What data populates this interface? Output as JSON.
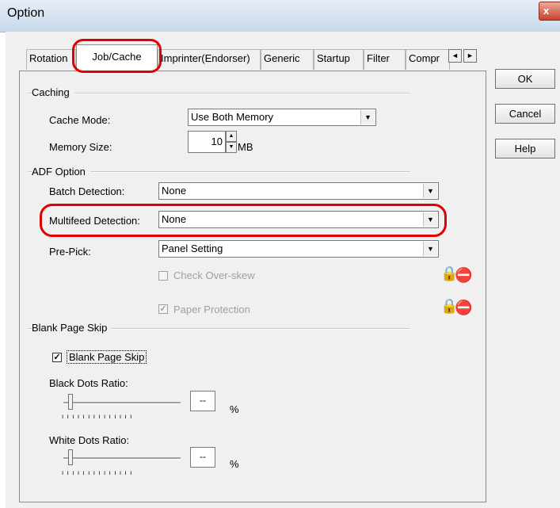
{
  "window": {
    "title": "Option",
    "close_glyph": "x"
  },
  "tabs": [
    {
      "label": "Rotation"
    },
    {
      "label": "Job/Cache"
    },
    {
      "label": "Imprinter(Endorser)"
    },
    {
      "label": "Generic"
    },
    {
      "label": "Startup"
    },
    {
      "label": "Filter"
    },
    {
      "label": "Compr"
    }
  ],
  "tab_scroll": {
    "left": "◄",
    "right": "►"
  },
  "buttons": {
    "ok": "OK",
    "cancel": "Cancel",
    "help": "Help"
  },
  "caching": {
    "group": "Caching",
    "cache_mode_label": "Cache Mode:",
    "cache_mode_value": "Use Both Memory",
    "memory_size_label": "Memory Size:",
    "memory_size_value": "10",
    "memory_unit": "MB"
  },
  "adf": {
    "group": "ADF Option",
    "batch_label": "Batch Detection:",
    "batch_value": "None",
    "multifeed_label": "Multifeed Detection:",
    "multifeed_value": "None",
    "prepick_label": "Pre-Pick:",
    "prepick_value": "Panel Setting",
    "overskew_label": "Check Over-skew",
    "paper_protection_label": "Paper Protection",
    "paper_protection_checked": "✓"
  },
  "blank": {
    "group": "Blank Page Skip",
    "checkbox_label": "Blank Page Skip",
    "checked": "✓",
    "black_label": "Black Dots Ratio:",
    "black_value": "--",
    "white_label": "White Dots Ratio:",
    "white_value": "--",
    "unit": "%",
    "ticks": "ıııııııııııııı"
  },
  "dropdown_arrow": "▼",
  "spin_up": "▲",
  "spin_down": "▼",
  "icons": {
    "lock_icon": "🔒",
    "no_icon": "⛔"
  },
  "colors": {
    "highlight_ring": "#e00000",
    "dialog_bg": "#f0f0f0"
  }
}
